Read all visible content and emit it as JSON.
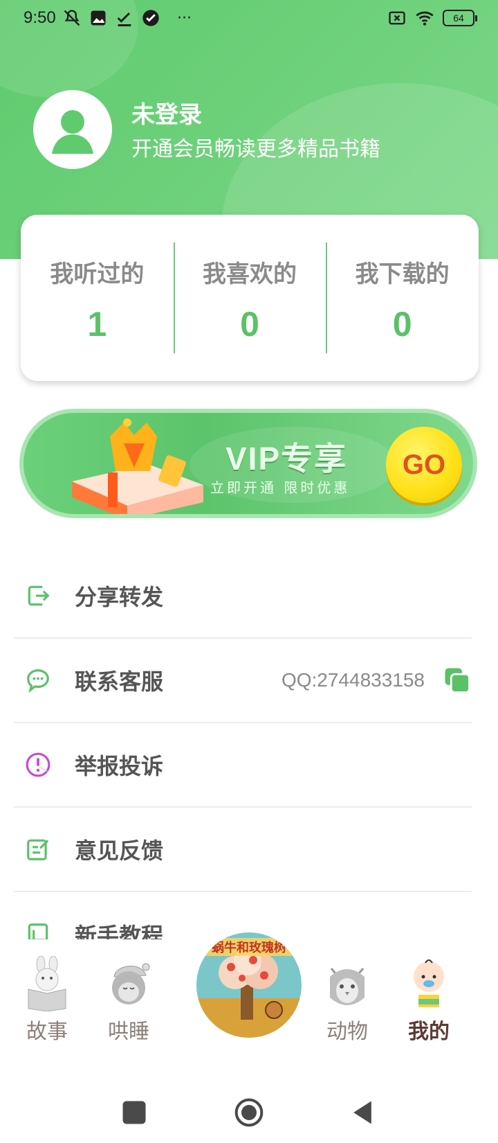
{
  "status_bar": {
    "time": "9:50",
    "battery": "64",
    "icons_left": [
      "mute-icon",
      "photo-icon",
      "check-download-icon",
      "verified-icon",
      "more-dots-icon"
    ],
    "icons_right": [
      "sim-off-icon",
      "wifi-icon",
      "battery-icon"
    ],
    "more": "···"
  },
  "profile": {
    "name": "未登录",
    "subtitle": "开通会员畅读更多精品书籍"
  },
  "stats": [
    {
      "label": "我听过的",
      "value": "1"
    },
    {
      "label": "我喜欢的",
      "value": "0"
    },
    {
      "label": "我下载的",
      "value": "0"
    }
  ],
  "vip_banner": {
    "title": "VIP专享",
    "subtitle": "立即开通 限时优惠",
    "go": "GO"
  },
  "menu": {
    "items": [
      {
        "label": "分享转发",
        "icon": "share-icon"
      },
      {
        "label": "联系客服",
        "icon": "chat-icon",
        "extra": "QQ:2744833158"
      },
      {
        "label": "举报投诉",
        "icon": "warning-icon"
      },
      {
        "label": "意见反馈",
        "icon": "feedback-icon"
      },
      {
        "label": "新手教程",
        "icon": "book-icon"
      }
    ]
  },
  "bottom_nav": {
    "items": [
      {
        "label": "故事"
      },
      {
        "label": "哄睡"
      },
      {
        "label": "动物"
      },
      {
        "label": "我的"
      }
    ],
    "center_banner": "蜗牛和玫瑰树"
  },
  "colors": {
    "brand_green": "#5fcb6e",
    "stat_value": "#5bc169",
    "nav_active": "#5b3b31"
  }
}
